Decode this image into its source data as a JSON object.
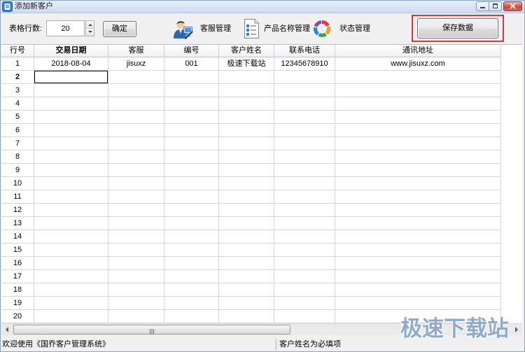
{
  "window": {
    "title": "添加新客户",
    "icon": "app-icon",
    "controls": [
      {
        "icon": "minimize-icon"
      },
      {
        "icon": "maximize-icon"
      },
      {
        "icon": "close-icon"
      }
    ]
  },
  "toolbar": {
    "rows_label": "表格行数:",
    "rows_value": "20",
    "confirm_label": "确定",
    "tools": [
      {
        "icon": "customer-service-icon",
        "label": "客服管理"
      },
      {
        "icon": "product-list-icon",
        "label": "产品名称管理"
      },
      {
        "icon": "status-cycle-icon",
        "label": "状态管理"
      }
    ],
    "save_label": "保存数据"
  },
  "grid": {
    "columns": [
      "行号",
      "交易日期",
      "客服",
      "编号",
      "客户姓名",
      "联系电话",
      "通讯地址"
    ],
    "rows": [
      {
        "cells": [
          "1",
          "2018-08-04",
          "jisuxz",
          "001",
          "极速下载站",
          "12345678910",
          "www.jisuxz.com"
        ]
      },
      {
        "cells": [
          "2",
          "",
          "",
          "",
          "",
          "",
          ""
        ],
        "current": true,
        "focused_cell": 1
      },
      {
        "cells": [
          "3",
          "",
          "",
          "",
          "",
          "",
          ""
        ]
      },
      {
        "cells": [
          "4",
          "",
          "",
          "",
          "",
          "",
          ""
        ]
      },
      {
        "cells": [
          "5",
          "",
          "",
          "",
          "",
          "",
          ""
        ]
      },
      {
        "cells": [
          "6",
          "",
          "",
          "",
          "",
          "",
          ""
        ]
      },
      {
        "cells": [
          "7",
          "",
          "",
          "",
          "",
          "",
          ""
        ]
      },
      {
        "cells": [
          "8",
          "",
          "",
          "",
          "",
          "",
          ""
        ]
      },
      {
        "cells": [
          "9",
          "",
          "",
          "",
          "",
          "",
          ""
        ]
      },
      {
        "cells": [
          "10",
          "",
          "",
          "",
          "",
          "",
          ""
        ]
      },
      {
        "cells": [
          "11",
          "",
          "",
          "",
          "",
          "",
          ""
        ]
      },
      {
        "cells": [
          "12",
          "",
          "",
          "",
          "",
          "",
          ""
        ]
      },
      {
        "cells": [
          "13",
          "",
          "",
          "",
          "",
          "",
          ""
        ]
      },
      {
        "cells": [
          "14",
          "",
          "",
          "",
          "",
          "",
          ""
        ]
      },
      {
        "cells": [
          "15",
          "",
          "",
          "",
          "",
          "",
          ""
        ]
      },
      {
        "cells": [
          "16",
          "",
          "",
          "",
          "",
          "",
          ""
        ]
      },
      {
        "cells": [
          "17",
          "",
          "",
          "",
          "",
          "",
          ""
        ]
      },
      {
        "cells": [
          "18",
          "",
          "",
          "",
          "",
          "",
          ""
        ]
      },
      {
        "cells": [
          "19",
          "",
          "",
          "",
          "",
          "",
          ""
        ]
      },
      {
        "cells": [
          "20",
          "",
          "",
          "",
          "",
          "",
          ""
        ]
      }
    ]
  },
  "status_bar": {
    "welcome": "欢迎使用《国乔客户管理系统》",
    "hint": "客户姓名为必填项"
  },
  "watermark": "极速下载站",
  "colors": {
    "save_highlight": "#d9373c",
    "close_button": "#c9473d",
    "app_icon": "#2f7fd0"
  }
}
